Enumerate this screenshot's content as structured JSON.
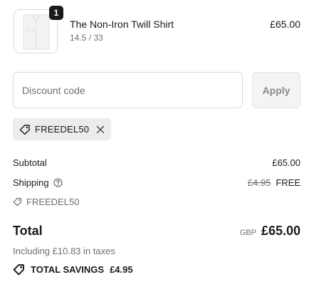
{
  "line_item": {
    "quantity": "1",
    "title": "The Non-Iron Twill Shirt",
    "variant": "14.5 / 33",
    "price": "£65.00"
  },
  "discount": {
    "placeholder": "Discount code",
    "apply_label": "Apply",
    "applied_code": "FREEDEL50"
  },
  "summary": {
    "subtotal_label": "Subtotal",
    "subtotal_value": "£65.00",
    "shipping_label": "Shipping",
    "shipping_old": "£4.95",
    "shipping_value": "FREE",
    "discount_code": "FREEDEL50",
    "total_label": "Total",
    "currency": "GBP",
    "total_value": "£65.00",
    "taxes_note": "Including £10.83 in taxes",
    "savings_label": "TOTAL SAVINGS",
    "savings_value": "£4.95"
  },
  "icons": {
    "tag": "tag-icon",
    "remove": "close-icon",
    "help": "question-circle-icon",
    "product": "shirt-thumbnail"
  }
}
